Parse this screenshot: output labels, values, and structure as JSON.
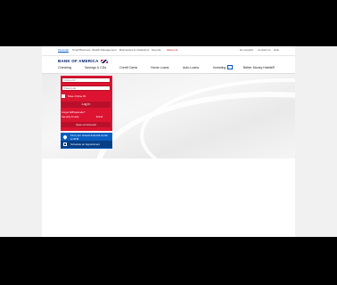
{
  "top_nav": {
    "left": [
      "Personal",
      "Small Business",
      "Wealth Management",
      "Businesses & Institutions",
      "Security",
      "About Us"
    ],
    "right": [
      "En español",
      "Contact Us",
      "Help"
    ]
  },
  "brand": {
    "name": "BANK OF AMERICA"
  },
  "main_nav": [
    "Checking",
    "Savings & CDs",
    "Credit Cards",
    "Home Loans",
    "Auto Loans",
    "Investing",
    "Better Money Habits®"
  ],
  "signin": {
    "online_id_placeholder": "Online ID",
    "passcode_placeholder": "Passcode",
    "save_id_label": "Save Online ID",
    "login_label": "Log In",
    "forgot_link": "Forgot ID/Passcode?",
    "security_link": "Security & Help",
    "enroll_link": "Enroll",
    "open_account_label": "Open an Account"
  },
  "locator": {
    "text": "Find your closest financial center or ATM"
  },
  "appointment": {
    "label": "Schedule an Appointment"
  },
  "colors": {
    "brand_red": "#dc1431",
    "brand_blue": "#012169",
    "locator_blue": "#0a5ec0"
  }
}
